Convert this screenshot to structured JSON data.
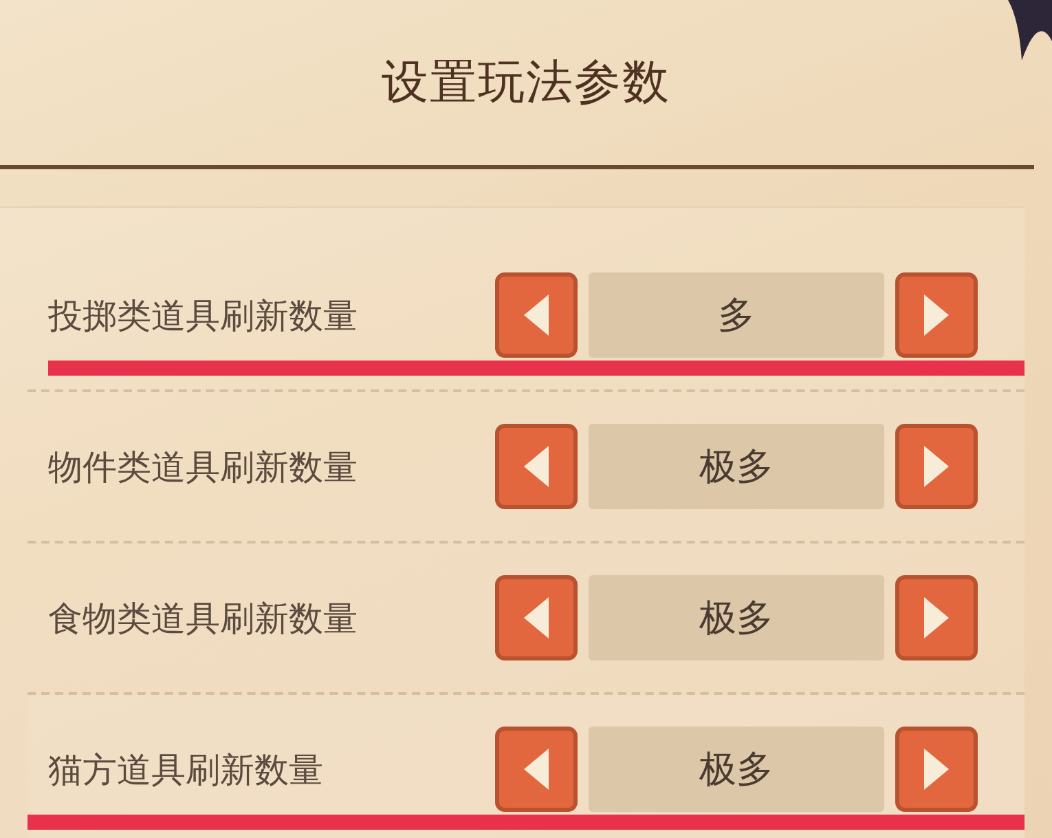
{
  "title": "设置玩法参数",
  "rows": [
    {
      "label": "投掷类道具刷新数量",
      "value": "多",
      "underlined": true
    },
    {
      "label": "物件类道具刷新数量",
      "value": "极多",
      "underlined": false
    },
    {
      "label": "食物类道具刷新数量",
      "value": "极多",
      "underlined": false
    },
    {
      "label": "猫方道具刷新数量",
      "value": "极多",
      "underlined": true
    }
  ]
}
